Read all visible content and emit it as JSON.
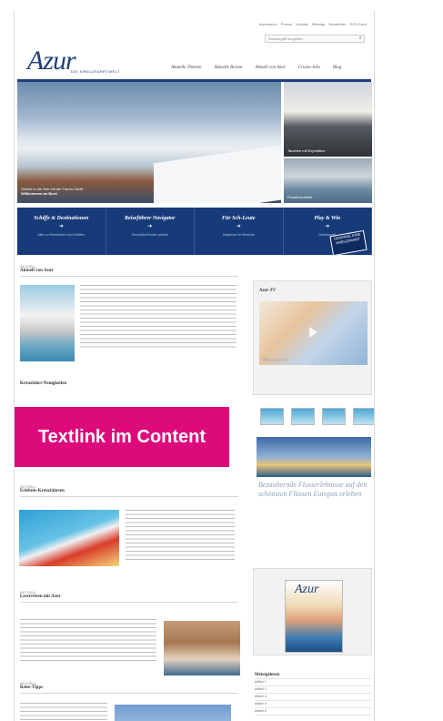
{
  "top_links": [
    "Impressum",
    "Presse",
    "Kontakt",
    "Sitemap",
    "Newsletter",
    "RSS-Feed"
  ],
  "search": {
    "placeholder": "Suchbegriff eingeben"
  },
  "logo": {
    "title": "Azur",
    "subtitle": "DIE KREUZFAHRTWELT"
  },
  "main_nav": [
    "Aktuelle Themen",
    "Aktuelle Reisen",
    "Aktuell von Azur",
    "Cruise-Jobs",
    "Blog"
  ],
  "hero": {
    "caption_line1": "Zurück in die See mit der Traum-Yacht",
    "caption_line2": "Willkommen an Bord"
  },
  "side_hero": {
    "caption1": "Tauchen mit Expedition",
    "caption2": "Flusskreuzfahrt"
  },
  "bluebar": {
    "items": [
      {
        "title": "Schiffe & Destinationen",
        "sub": "Alles zu Reisezielen und Schiffen"
      },
      {
        "title": "Reiseführer Navigator",
        "sub": "Kreuzfahrt-Routen planen"
      },
      {
        "title": "Für Sch-Leute",
        "sub": "Angebote für Seeleute"
      },
      {
        "title": "Play & Win",
        "sub": "Gewinnspiel"
      }
    ],
    "badge": "GEWINNE EINE KREUZFAHRT"
  },
  "articles": [
    {
      "meta": "AKTUELL",
      "title": "Aktuell von Azur"
    },
    {
      "meta": "AKTUELL",
      "title": "Kreuzfahrt-Neuigkeiten"
    },
    {
      "meta": "AKTUELL",
      "title": "Erlebnis-Kreuzfahrten"
    },
    {
      "meta": "AKTUELL",
      "title": "Leserreisen mit Azur"
    },
    {
      "meta": "AKTUELL",
      "title": "Reise-Tipps"
    }
  ],
  "textlink_block": "Textlink im Content",
  "sidebar": {
    "video_title": "Azur-TV",
    "video_caption": "Video ansehen",
    "river_text": "Bezaubernde Flusserlebnisse auf den schönsten Flüssen Europas erleben",
    "magazine_label": "Azur",
    "list_title": "Meistgelesen",
    "list_items": [
      "Artikel 1",
      "Artikel 2",
      "Artikel 3",
      "Artikel 4",
      "Artikel 5"
    ]
  }
}
